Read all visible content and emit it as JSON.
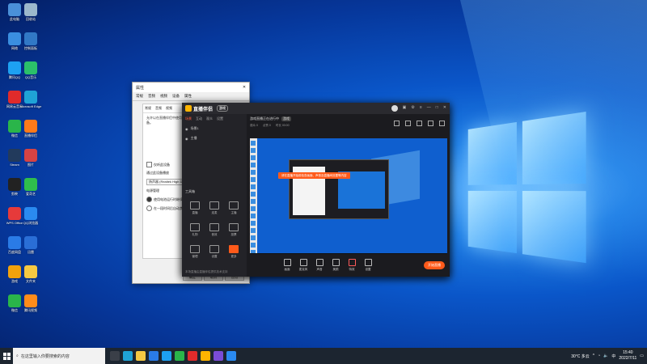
{
  "desktop": {
    "icons": [
      {
        "label": "此电脑",
        "color": "#4a90d9"
      },
      {
        "label": "回收站",
        "color": "#9bb8cc"
      },
      {
        "label": "网络",
        "color": "#3a8ee0"
      },
      {
        "label": "控制面板",
        "color": "#3178c6"
      },
      {
        "label": "腾讯QQ",
        "color": "#1da1f2"
      },
      {
        "label": "QQ音乐",
        "color": "#2bc06a"
      },
      {
        "label": "网易云音乐",
        "color": "#e02b2b"
      },
      {
        "label": "Microsoft Edge",
        "color": "#1fa3d6"
      },
      {
        "label": "微信",
        "color": "#2ab54a"
      },
      {
        "label": "直播伴侣",
        "color": "#ff7a1a"
      },
      {
        "label": "Steam",
        "color": "#223a5c"
      },
      {
        "label": "图片",
        "color": "#d64343"
      },
      {
        "label": "剪映",
        "color": "#222222"
      },
      {
        "label": "爱奇艺",
        "color": "#2fbe4c"
      },
      {
        "label": "WPS Office",
        "color": "#e63a3a"
      },
      {
        "label": "QQ浏览器",
        "color": "#2a8af0"
      },
      {
        "label": "百度网盘",
        "color": "#2a7be6"
      },
      {
        "label": "迅雷",
        "color": "#2a6ed6"
      },
      {
        "label": "游戏",
        "color": "#f2a20c"
      },
      {
        "label": "文件夹",
        "color": "#f5c842"
      },
      {
        "label": "微信",
        "color": "#2ab54a"
      },
      {
        "label": "腾讯视频",
        "color": "#ff8c1a"
      }
    ]
  },
  "dialog": {
    "title": "属性",
    "tabs": [
      "常规",
      "音频",
      "视频",
      "设备",
      "属性"
    ],
    "inner_tabs": [
      "常规",
      "音频",
      "视频"
    ],
    "description": "允许以在直播伴侣中使用的音频、视频设备，在此可以选择设备。",
    "checkbox1": "仅听此设备",
    "device_label": "通过此设备播放",
    "device_select": "扬声器 (Realtek High Definition Audio)",
    "power_label": "电源管理",
    "radio1": "使用电池运行时继续运行",
    "radio2": "在一段时间后自动禁用",
    "ok": "确定",
    "cancel": "取消",
    "apply": "应用"
  },
  "app": {
    "name": "直播伴侣",
    "version": "游戏",
    "left_tabs": [
      "场景",
      "互动",
      "观众",
      "设置"
    ],
    "scene_rows": [
      "场景1",
      "主播"
    ],
    "tools_title": "工具箱",
    "tools": [
      {
        "label": "直播",
        "hot": false
      },
      {
        "label": "连麦",
        "hot": false
      },
      {
        "label": "主播",
        "hot": false
      },
      {
        "label": "礼物",
        "hot": false
      },
      {
        "label": "音效",
        "hot": false
      },
      {
        "label": "投票",
        "hot": false
      },
      {
        "label": "管理",
        "hot": false
      },
      {
        "label": "设置",
        "hot": false
      },
      {
        "label": "更多",
        "hot": true
      }
    ],
    "footer_note": "本场直播由直播伴侣提供技术支持",
    "room_title": "游戏直播正在进行中",
    "room_tag": "游戏",
    "room_meta": [
      "观众 0",
      "点赞 0",
      "时长 00:00"
    ],
    "banner": "请在直播开始前检查画面、声音及直播间设置等内容",
    "controls": [
      "画面",
      "麦克风",
      "声音",
      "美颜",
      "特效",
      "设置"
    ],
    "start_button": "开始直播"
  },
  "taskbar": {
    "search_placeholder": "在这里输入你要搜索的内容",
    "apps": [
      {
        "name": "task-view-icon",
        "color": "#3a3f48"
      },
      {
        "name": "edge-icon",
        "color": "#1fa3d6"
      },
      {
        "name": "explorer-icon",
        "color": "#f5c842"
      },
      {
        "name": "store-icon",
        "color": "#2a7be6"
      },
      {
        "name": "qq-icon",
        "color": "#1da1f2"
      },
      {
        "name": "wechat-icon",
        "color": "#2ab54a"
      },
      {
        "name": "music-icon",
        "color": "#e02b2b"
      },
      {
        "name": "streaming-app-icon",
        "color": "#ffb400"
      },
      {
        "name": "game-icon",
        "color": "#7a4cd6"
      },
      {
        "name": "browser-icon",
        "color": "#2a8af0"
      }
    ],
    "weather": "30°C 多云",
    "ime": "中",
    "time": "15:40",
    "date": "2022/7/11"
  }
}
